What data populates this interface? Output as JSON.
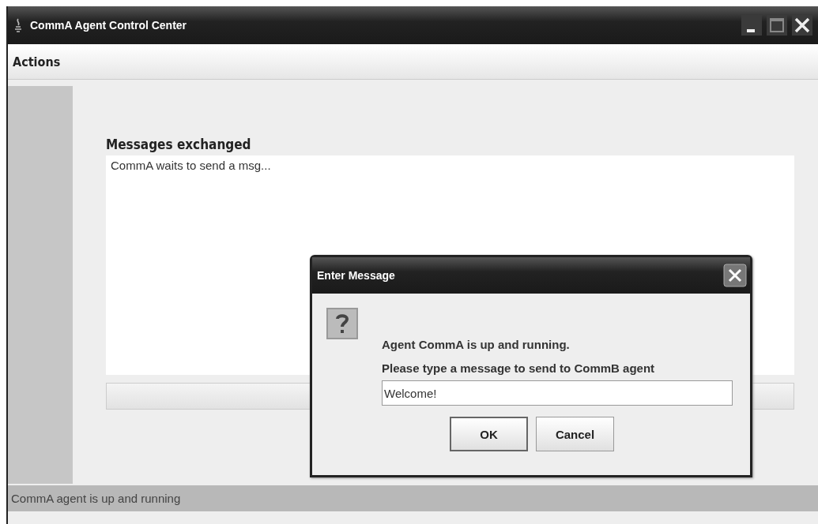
{
  "window": {
    "title": "CommA Agent Control Center"
  },
  "menu_bar": {
    "items": [
      {
        "label": "Actions"
      }
    ]
  },
  "messages": {
    "heading": "Messages exchanged",
    "log": "CommA waits to send a msg..."
  },
  "status_bar": "CommA agent is up and running",
  "dialog": {
    "title": "Enter Message",
    "lines": [
      "Agent CommA is up and running.",
      "Please type a message to send to CommB agent"
    ],
    "input_value": "Welcome!",
    "buttons": [
      {
        "label": "OK",
        "default": true
      },
      {
        "label": "Cancel",
        "default": false
      }
    ]
  }
}
